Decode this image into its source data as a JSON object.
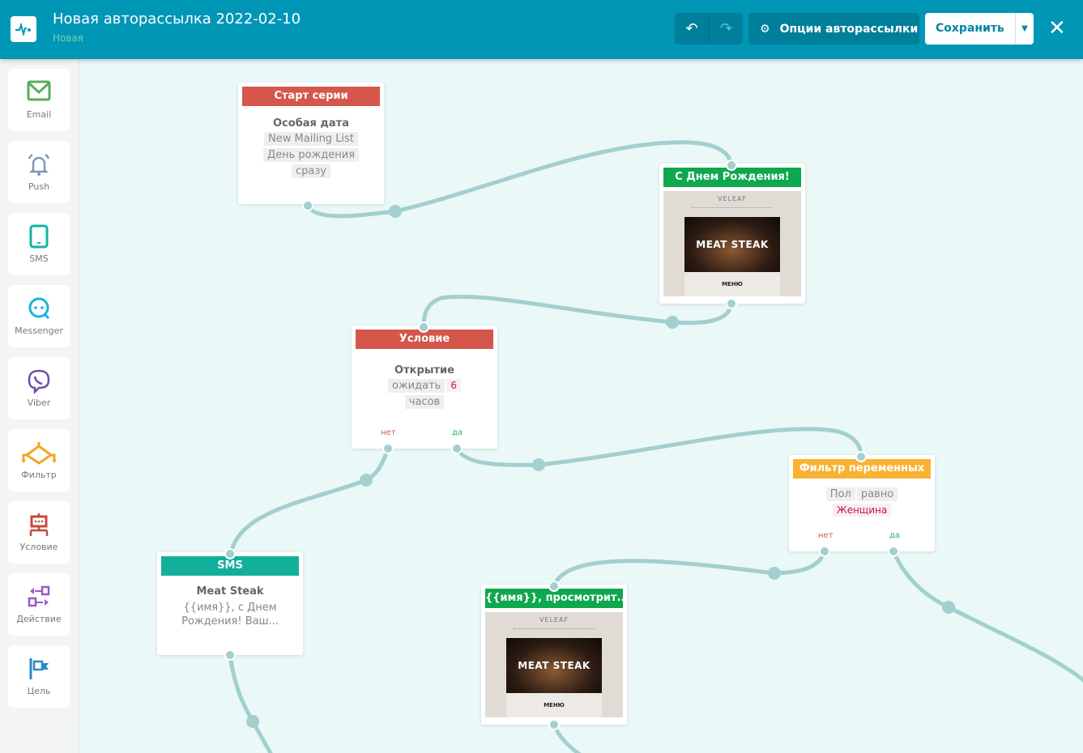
{
  "header": {
    "title": "Новая авторассылка 2022-02-10",
    "status": "Новая",
    "undo_icon": "undo-icon",
    "redo_icon": "redo-icon",
    "options_label": "Опции авторассылки",
    "save_label": "Сохранить",
    "brand_color": "#0096b6"
  },
  "sidebar": {
    "items": [
      {
        "label": "Email",
        "icon": "envelope-icon",
        "color": "#5aab5e"
      },
      {
        "label": "Push",
        "icon": "bell-icon",
        "color": "#7c98b6"
      },
      {
        "label": "SMS",
        "icon": "phone-icon",
        "color": "#12b5a0"
      },
      {
        "label": "Messenger",
        "icon": "chat-icon",
        "color": "#1ab4dc"
      },
      {
        "label": "Viber",
        "icon": "viber-icon",
        "color": "#6b4fa6"
      },
      {
        "label": "Фильтр",
        "icon": "filter-icon",
        "color": "#f3a523"
      },
      {
        "label": "Условие",
        "icon": "robot-icon",
        "color": "#c6493f"
      },
      {
        "label": "Действие",
        "icon": "action-icon",
        "color": "#9b59c7"
      },
      {
        "label": "Цель",
        "icon": "flag-icon",
        "color": "#2a89c9"
      }
    ]
  },
  "nodes": {
    "start": {
      "header": "Старт серии",
      "title": "Особая дата",
      "chips": [
        "New Mailing List",
        "День рождения",
        "сразу"
      ],
      "color": "#d5574b"
    },
    "birthday": {
      "header": "С Днем Рождения!",
      "color": "#0ea84e",
      "preview": {
        "brand": "VELEAF",
        "hero": "MEAT STEAK",
        "menu": "МЕНЮ"
      }
    },
    "condition": {
      "header": "Условие",
      "title": "Открытие",
      "wait": "ожидать",
      "value": "6",
      "unit": "часов",
      "no": "нет",
      "yes": "да",
      "color": "#d5574b"
    },
    "filter": {
      "header": "Фильтр переменных",
      "field": "Пол",
      "op": "равно",
      "value": "Женщина",
      "no": "нет",
      "yes": "да",
      "color": "#f9b233"
    },
    "sms": {
      "header": "SMS",
      "title": "Meat Steak",
      "text": "{{имя}}, с Днем Рождения! Ваш...",
      "color": "#12b09a"
    },
    "email2": {
      "header": "{{имя}}, просмотрит...",
      "color": "#0ea84e",
      "preview": {
        "brand": "VELEAF",
        "hero": "MEAT STEAK",
        "menu": "МЕНЮ"
      }
    }
  }
}
